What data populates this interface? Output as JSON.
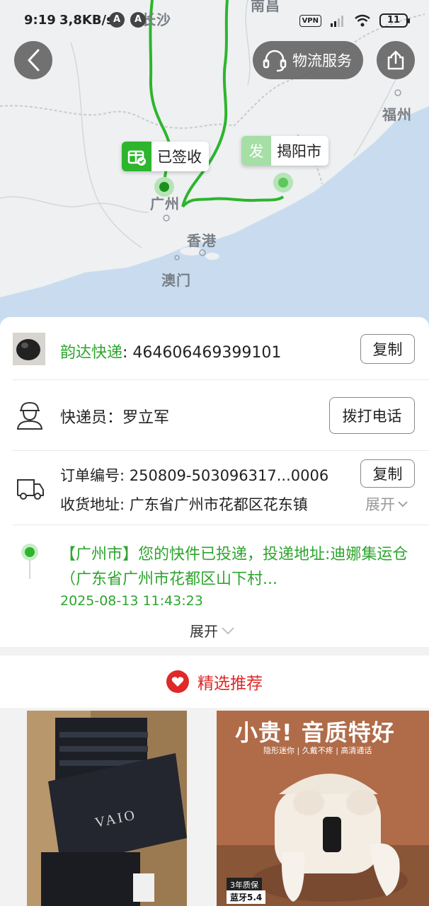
{
  "status_bar": {
    "time": "9:19",
    "speed": "3,8KB/s",
    "app_icon_letter": "A",
    "vpn": "VPN",
    "battery": "11"
  },
  "map": {
    "city_labels": {
      "changsha": "长沙",
      "nanchang": "南昌",
      "fuzhou": "福州",
      "guangzhou": "广州",
      "hongkong": "香港",
      "macau": "澳门"
    },
    "signed_tag": "已签收",
    "origin_fa": "发",
    "origin_city": "揭阳市",
    "route_color": "#2db52d"
  },
  "header": {
    "logistics_label": "物流服务"
  },
  "shipment": {
    "carrier": "韵达快递",
    "tracking_number": ": 464606469399101",
    "copy_label": "复制",
    "courier_line": "快递员：罗立军",
    "call_label": "拨打电话",
    "order_line": "订单编号: 250809-503096317...0006",
    "order_copy_label": "复制",
    "address_line": "收货地址: 广东省广州市花都区花东镇",
    "address_expand": "展开",
    "latest_event": "【广州市】您的快件已投递，投递地址:迪娜集运仓（广东省广州市花都区山下村...",
    "latest_time": "2025-08-13 11:43:23",
    "expand_label": "展开"
  },
  "recommend": {
    "title": "精选推荐",
    "products": [
      {
        "brand_text": "VAIO"
      },
      {
        "headline": "小贵! 音质特好",
        "subline": "隐形迷你 | 久戴不疼 | 高清通话",
        "badge1": "3年质保",
        "badge2": "蓝牙5.4"
      }
    ]
  },
  "colors": {
    "accent_green": "#2ea52e",
    "accent_red": "#e02828"
  }
}
